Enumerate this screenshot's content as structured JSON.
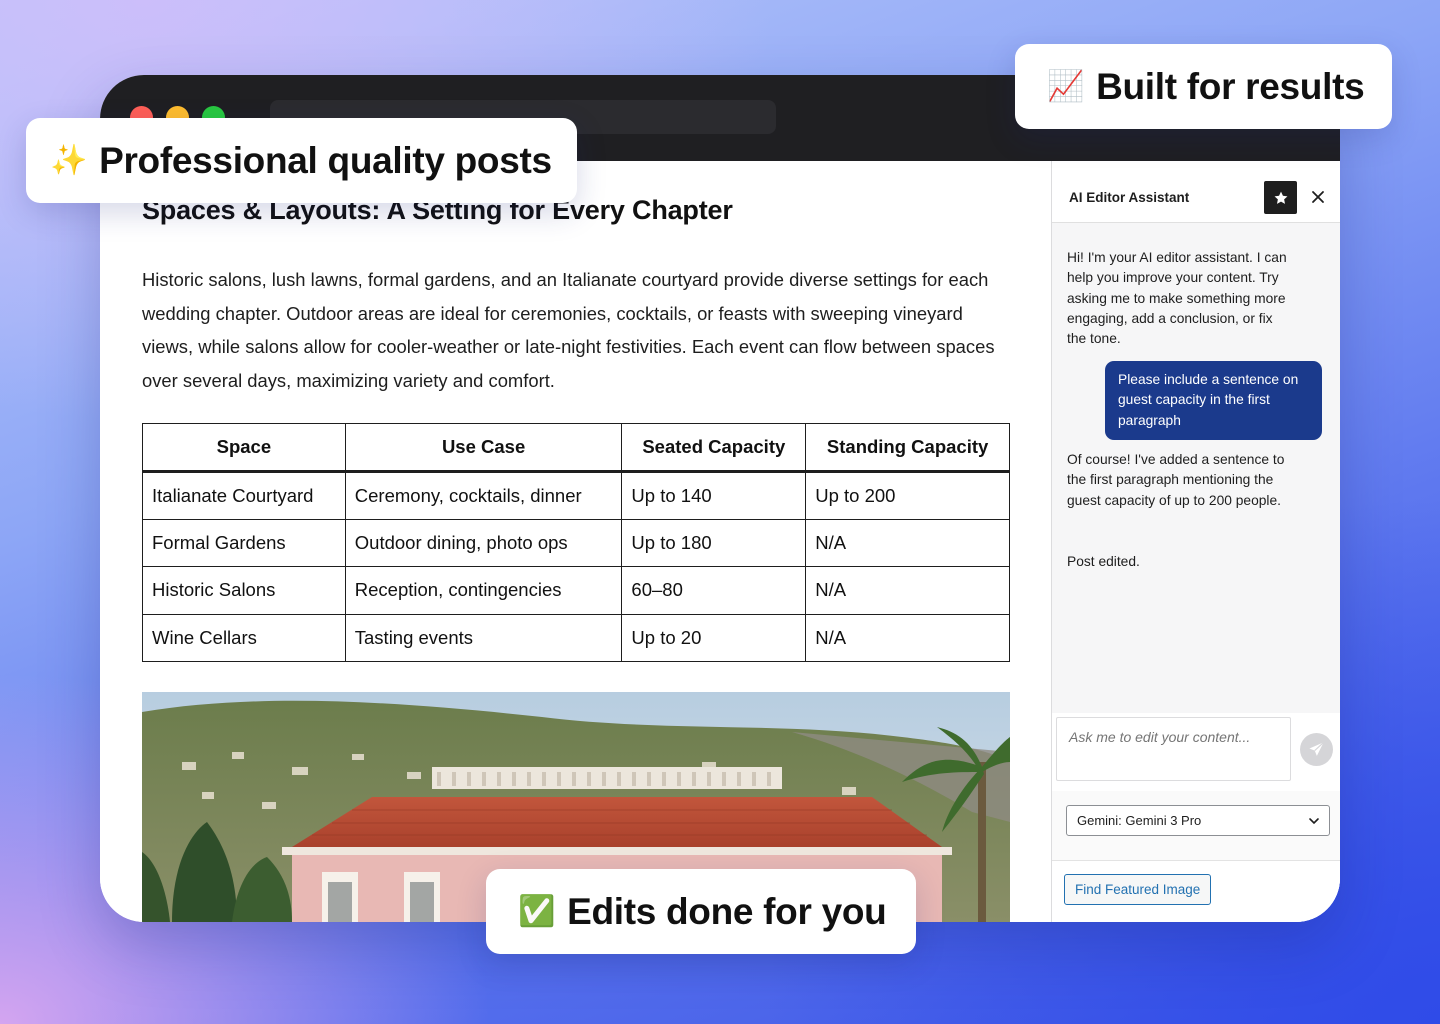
{
  "badges": {
    "professional": {
      "emoji": "✨",
      "label": "Professional quality posts"
    },
    "results": {
      "emoji": "📈",
      "label": "Built for results"
    },
    "edits": {
      "emoji": "✅",
      "label": "Edits done for you"
    }
  },
  "post": {
    "heading": "Spaces & Layouts: A Setting for Every Chapter",
    "paragraph": "Historic salons, lush lawns, formal gardens, and an Italianate courtyard provide diverse settings for each wedding chapter. Outdoor areas are ideal for ceremonies, cocktails, or feasts with sweeping vineyard views, while salons allow for cooler-weather or late-night festivities. Each event can flow between spaces over several days, maximizing variety and comfort.",
    "table": {
      "headers": [
        "Space",
        "Use Case",
        "Seated Capacity",
        "Standing Capacity"
      ],
      "rows": [
        [
          "Italianate Courtyard",
          "Ceremony, cocktails, dinner",
          "Up to 140",
          "Up to 200"
        ],
        [
          "Formal Gardens",
          "Outdoor dining, photo ops",
          "Up to 180",
          "N/A"
        ],
        [
          "Historic Salons",
          "Reception, contingencies",
          "60–80",
          "N/A"
        ],
        [
          "Wine Cellars",
          "Tasting events",
          "Up to 20",
          "N/A"
        ]
      ]
    }
  },
  "assistant": {
    "title": "AI Editor Assistant",
    "messages": {
      "greeting": "Hi! I'm your AI editor assistant. I can help you improve your content. Try asking me to make something more engaging, add a conclusion, or fix the tone.",
      "user_request": "Please include a sentence on guest capacity in the first paragraph",
      "reply": "Of course! I've added a sentence to the first paragraph mentioning the guest capacity of up to 200 people.",
      "status": "Post edited."
    },
    "input_placeholder": "Ask me to edit your content...",
    "model_selected": "Gemini: Gemini 3 Pro",
    "featured_image_button": "Find Featured Image"
  },
  "colors": {
    "user_bubble": "#1b3a8c",
    "link_blue": "#2271b1",
    "titlebar": "#1f1f22"
  }
}
